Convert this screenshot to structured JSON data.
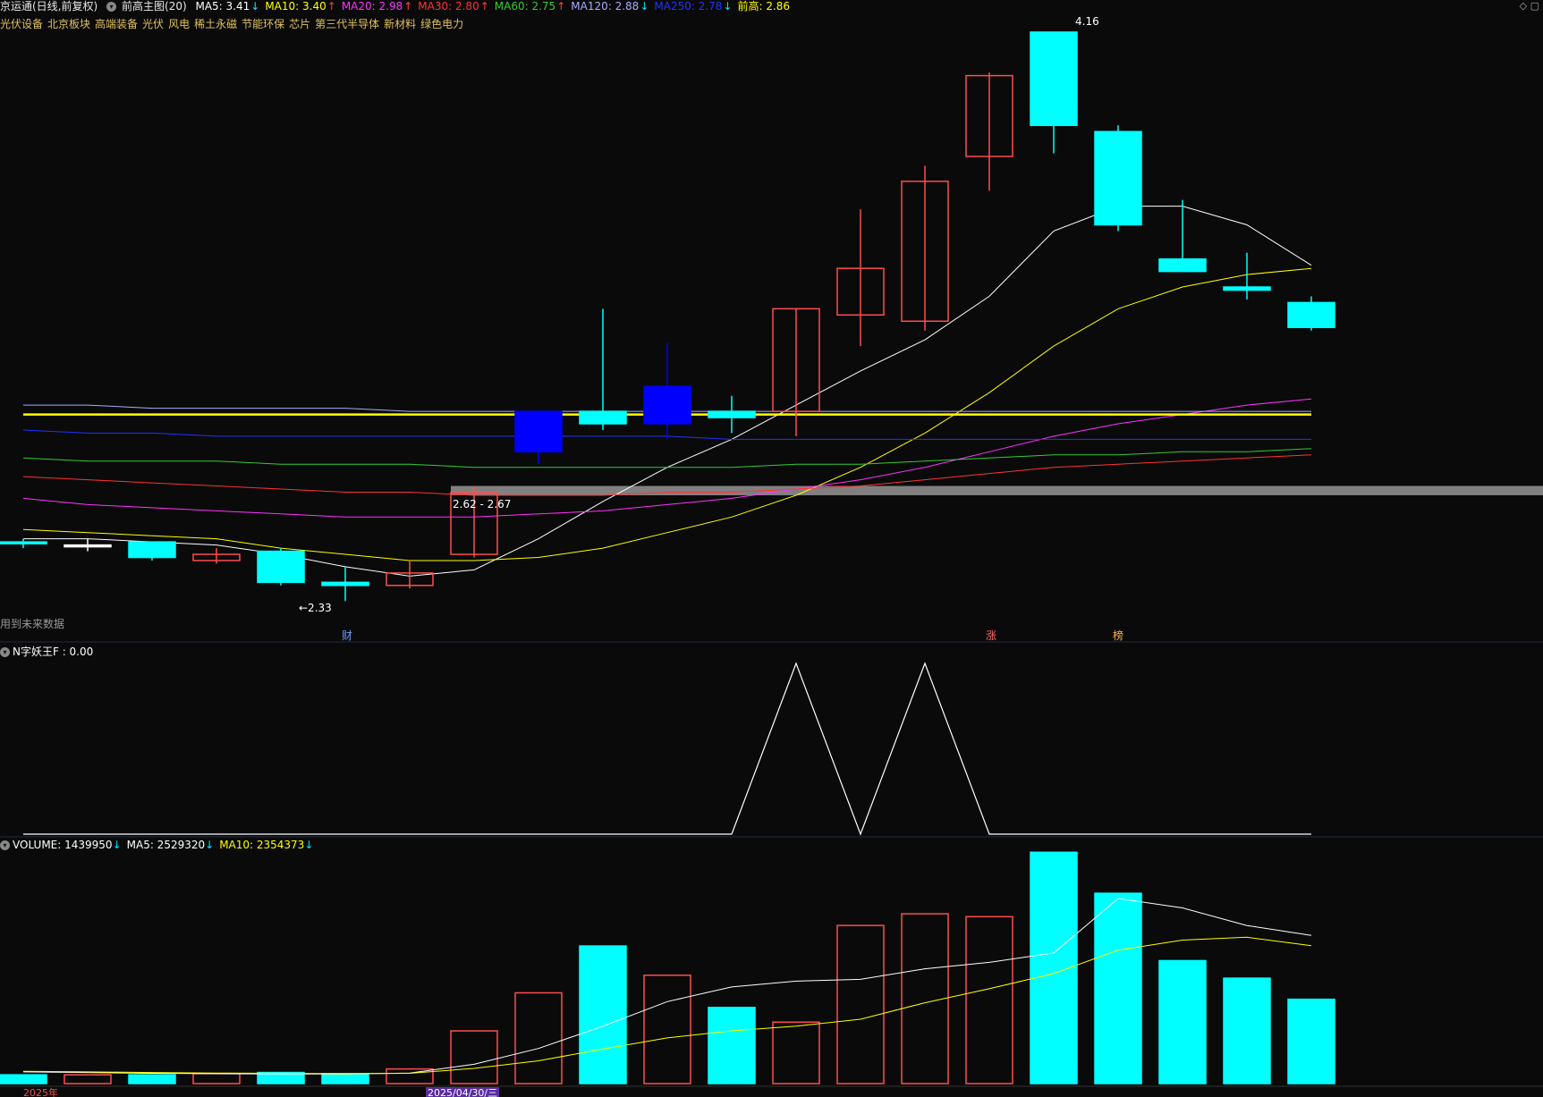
{
  "header": {
    "stock": "京运通(日线,前复权)",
    "indicator": "前高主图(20)",
    "ma": [
      {
        "label": "MA5: 3.41",
        "arrow": "↓",
        "color": "#ffffff",
        "arrowColor": "#00e5ff"
      },
      {
        "label": "MA10: 3.40",
        "arrow": "↑",
        "color": "#ffff00",
        "arrowColor": "#ff4040"
      },
      {
        "label": "MA20: 2.98",
        "arrow": "↑",
        "color": "#ff33ff",
        "arrowColor": "#ff4040"
      },
      {
        "label": "MA30: 2.80",
        "arrow": "↑",
        "color": "#ff3333",
        "arrowColor": "#ff4040"
      },
      {
        "label": "MA60: 2.75",
        "arrow": "↑",
        "color": "#33cc33",
        "arrowColor": "#ff4040"
      },
      {
        "label": "MA120: 2.88",
        "arrow": "↓",
        "color": "#aaaaff",
        "arrowColor": "#00e5ff"
      },
      {
        "label": "MA250: 2.78",
        "arrow": "↓",
        "color": "#2233ff",
        "arrowColor": "#00e5ff"
      },
      {
        "label": "前高: 2.86",
        "arrow": "",
        "color": "#ffff00",
        "arrowColor": "#ffff00"
      }
    ],
    "right_icons": "◇ ▢"
  },
  "sectors": [
    "光伏设备",
    "北京板块",
    "高端装备",
    "光伏",
    "风电",
    "稀土永磁",
    "节能环保",
    "芯片",
    "第三代半导体",
    "新材料",
    "绿色电力"
  ],
  "main_labels": {
    "high_label": "4.16",
    "low_label": "←2.33",
    "zone_label": "2.62 - 2.67",
    "future_note": "用到未来数据",
    "marker_cai": "财",
    "marker_zhang": "涨",
    "marker_bang": "榜"
  },
  "indicator_panel": {
    "title": "N字妖王F : 0.00"
  },
  "volume_panel": {
    "title": "VOLUME: 1439950",
    "title_arrow": "↓",
    "ma5": "MA5: 2529320",
    "ma5_arrow": "↓",
    "ma10": "MA10: 2354373",
    "ma10_arrow": "↓"
  },
  "x_axis": {
    "left_label": "2025年",
    "date_label": "2025/04/30/三"
  },
  "colors": {
    "up": "#ff4d4d",
    "down_cyan": "#00ffff",
    "down_blue": "#0000ff",
    "background": "#0a0a0a",
    "yellow_line": "#ffff00",
    "zone": "#808080"
  },
  "chart_data": [
    {
      "type": "candlestick",
      "name": "price",
      "ylim": [
        2.25,
        4.2
      ],
      "candles": [
        {
          "o": 2.52,
          "h": 2.53,
          "l": 2.5,
          "c": 2.52,
          "color": "cyan"
        },
        {
          "o": 2.51,
          "h": 2.53,
          "l": 2.49,
          "c": 2.51,
          "color": "white"
        },
        {
          "o": 2.52,
          "h": 2.52,
          "l": 2.46,
          "c": 2.47,
          "color": "cyan"
        },
        {
          "o": 2.46,
          "h": 2.5,
          "l": 2.45,
          "c": 2.48,
          "color": "red"
        },
        {
          "o": 2.49,
          "h": 2.5,
          "l": 2.38,
          "c": 2.39,
          "color": "cyan"
        },
        {
          "o": 2.39,
          "h": 2.44,
          "l": 2.33,
          "c": 2.38,
          "color": "cyan"
        },
        {
          "o": 2.38,
          "h": 2.46,
          "l": 2.37,
          "c": 2.42,
          "color": "red"
        },
        {
          "o": 2.48,
          "h": 2.7,
          "l": 2.47,
          "c": 2.68,
          "color": "red"
        },
        {
          "o": 2.94,
          "h": 2.94,
          "l": 2.77,
          "c": 2.81,
          "color": "blue"
        },
        {
          "o": 2.94,
          "h": 3.27,
          "l": 2.88,
          "c": 2.9,
          "color": "cyan"
        },
        {
          "o": 2.9,
          "h": 3.16,
          "l": 2.85,
          "c": 3.02,
          "color": "blue"
        },
        {
          "o": 2.94,
          "h": 2.99,
          "l": 2.87,
          "c": 2.92,
          "color": "cyan"
        },
        {
          "o": 2.94,
          "h": 3.27,
          "l": 2.86,
          "c": 3.27,
          "color": "red"
        },
        {
          "o": 3.25,
          "h": 3.59,
          "l": 3.15,
          "c": 3.4,
          "color": "red"
        },
        {
          "o": 3.23,
          "h": 3.73,
          "l": 3.2,
          "c": 3.68,
          "color": "red"
        },
        {
          "o": 3.76,
          "h": 4.03,
          "l": 3.65,
          "c": 4.02,
          "color": "red"
        },
        {
          "o": 4.16,
          "h": 4.16,
          "l": 3.77,
          "c": 3.86,
          "color": "cyan"
        },
        {
          "o": 3.84,
          "h": 3.86,
          "l": 3.52,
          "c": 3.54,
          "color": "cyan"
        },
        {
          "o": 3.43,
          "h": 3.62,
          "l": 3.39,
          "c": 3.39,
          "color": "cyan"
        },
        {
          "o": 3.34,
          "h": 3.45,
          "l": 3.3,
          "c": 3.33,
          "color": "cyan"
        },
        {
          "o": 3.29,
          "h": 3.31,
          "l": 3.2,
          "c": 3.21,
          "color": "cyan"
        }
      ],
      "lines": [
        {
          "name": "MA5",
          "color": "#ffffff",
          "values": [
            2.53,
            2.53,
            2.52,
            2.51,
            2.48,
            2.44,
            2.41,
            2.43,
            2.53,
            2.65,
            2.76,
            2.85,
            2.96,
            3.07,
            3.17,
            3.31,
            3.52,
            3.6,
            3.6,
            3.54,
            3.41
          ]
        },
        {
          "name": "MA10",
          "color": "#ffff00",
          "values": [
            2.56,
            2.55,
            2.54,
            2.53,
            2.5,
            2.48,
            2.46,
            2.46,
            2.47,
            2.5,
            2.55,
            2.6,
            2.67,
            2.76,
            2.87,
            3.0,
            3.15,
            3.27,
            3.34,
            3.38,
            3.4
          ]
        },
        {
          "name": "MA20",
          "color": "#ff33ff",
          "values": [
            2.66,
            2.64,
            2.63,
            2.62,
            2.61,
            2.6,
            2.6,
            2.6,
            2.61,
            2.62,
            2.64,
            2.66,
            2.69,
            2.72,
            2.76,
            2.81,
            2.86,
            2.9,
            2.93,
            2.96,
            2.98
          ]
        },
        {
          "name": "MA30",
          "color": "#ff3333",
          "values": [
            2.73,
            2.72,
            2.71,
            2.7,
            2.69,
            2.68,
            2.68,
            2.67,
            2.67,
            2.67,
            2.68,
            2.68,
            2.69,
            2.7,
            2.72,
            2.74,
            2.76,
            2.77,
            2.78,
            2.79,
            2.8
          ]
        },
        {
          "name": "MA60",
          "color": "#33cc33",
          "values": [
            2.79,
            2.78,
            2.78,
            2.78,
            2.77,
            2.77,
            2.77,
            2.76,
            2.76,
            2.76,
            2.76,
            2.76,
            2.77,
            2.77,
            2.78,
            2.79,
            2.8,
            2.8,
            2.81,
            2.81,
            2.82
          ]
        },
        {
          "name": "MA120",
          "color": "#aaaaff",
          "values": [
            2.96,
            2.96,
            2.95,
            2.95,
            2.95,
            2.95,
            2.94,
            2.94,
            2.94,
            2.94,
            2.94,
            2.94,
            2.94,
            2.94,
            2.94,
            2.94,
            2.94,
            2.94,
            2.94,
            2.94,
            2.94
          ]
        },
        {
          "name": "MA250",
          "color": "#2233ff",
          "values": [
            2.88,
            2.87,
            2.87,
            2.86,
            2.86,
            2.86,
            2.86,
            2.86,
            2.86,
            2.86,
            2.86,
            2.85,
            2.85,
            2.85,
            2.85,
            2.85,
            2.85,
            2.85,
            2.85,
            2.85,
            2.85
          ]
        }
      ],
      "resistance_line": 2.93,
      "zone": [
        2.67,
        2.7
      ]
    },
    {
      "type": "line",
      "name": "N字妖王F",
      "ylim": [
        0,
        1
      ],
      "values": [
        0,
        0,
        0,
        0,
        0,
        0,
        0,
        0,
        0,
        0,
        0,
        0,
        1,
        0,
        1,
        0,
        0,
        0,
        0,
        0,
        0
      ]
    },
    {
      "type": "bar",
      "name": "VOLUME",
      "ylim": [
        0,
        4000000
      ],
      "values": [
        150000,
        150000,
        150000,
        170000,
        190000,
        170000,
        250000,
        900000,
        1550000,
        2350000,
        1850000,
        1300000,
        1050000,
        2700000,
        2900000,
        2850000,
        3950000,
        3250000,
        2100000,
        1800000,
        1439950
      ],
      "colors": [
        "cyan",
        "red",
        "cyan",
        "red",
        "cyan",
        "cyan",
        "red",
        "red",
        "red",
        "cyan",
        "red",
        "cyan",
        "red",
        "red",
        "red",
        "red",
        "cyan",
        "cyan",
        "cyan",
        "cyan",
        "cyan"
      ],
      "lines": [
        {
          "name": "MA5",
          "color": "#ffffff",
          "values": [
            200000,
            190000,
            175000,
            170000,
            165000,
            165000,
            180000,
            330000,
            600000,
            980000,
            1400000,
            1650000,
            1750000,
            1780000,
            1960000,
            2070000,
            2230000,
            3160000,
            3000000,
            2700000,
            2529320
          ]
        },
        {
          "name": "MA10",
          "color": "#ffff00",
          "values": [
            210000,
            200000,
            190000,
            180000,
            175000,
            170000,
            175000,
            260000,
            390000,
            590000,
            780000,
            900000,
            980000,
            1100000,
            1380000,
            1620000,
            1880000,
            2280000,
            2450000,
            2500000,
            2354373
          ]
        }
      ]
    }
  ]
}
